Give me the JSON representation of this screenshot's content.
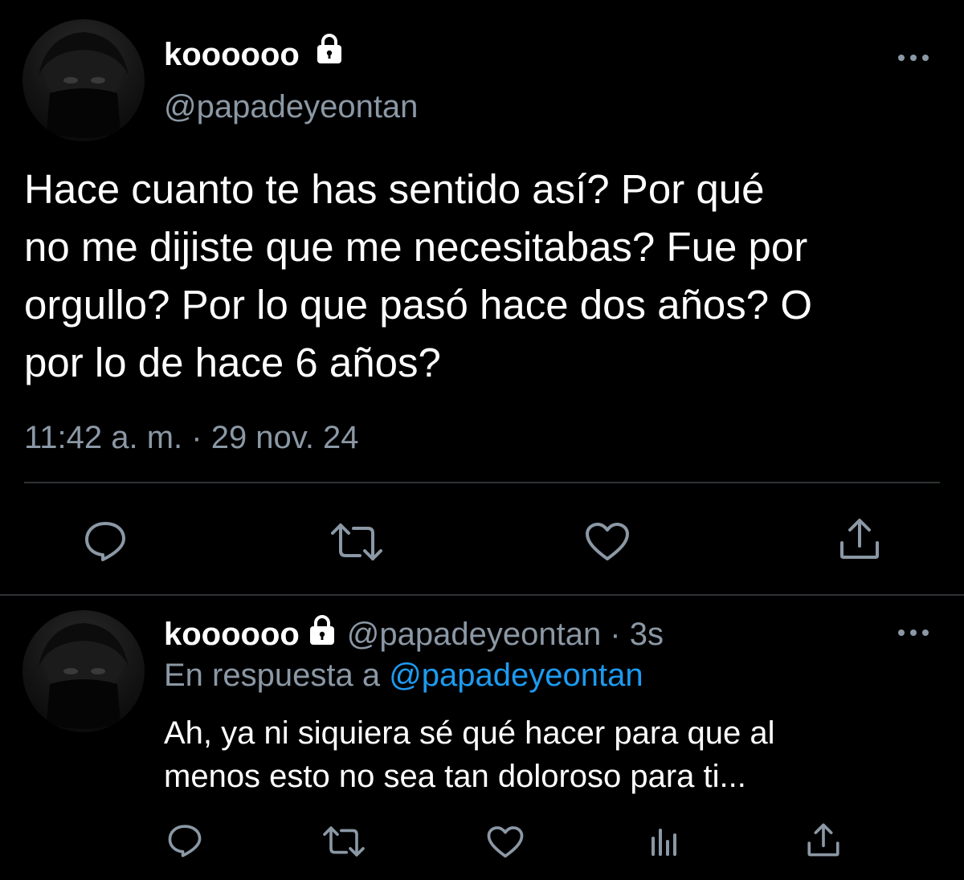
{
  "main_tweet": {
    "display_name": "koooooo",
    "handle": "@papadeyeontan",
    "text_lines": [
      "Hace cuanto te has sentido así? Por qué",
      "no me dijiste que me necesitabas? Fue por",
      "orgullo? Por lo que pasó hace dos años? O",
      "por lo de hace 6 años?"
    ],
    "timestamp": "11:42 a. m. · 29 nov. 24",
    "more_icon": "more-dots-icon",
    "actions": [
      "reply-icon",
      "retweet-icon",
      "like-icon",
      "share-icon"
    ]
  },
  "reply_tweet": {
    "display_name": "koooooo",
    "handle_time": "@papadeyeontan · 3s",
    "replying_prefix": "En respuesta a",
    "replying_to": "@papadeyeontan",
    "text_lines": [
      "Ah, ya ni siquiera sé qué hacer para que al",
      "menos esto no sea tan doloroso para ti..."
    ],
    "more_icon": "more-dots-icon",
    "actions": [
      "reply-icon",
      "retweet-icon",
      "like-icon",
      "analytics-icon",
      "share-icon"
    ]
  },
  "colors": {
    "background": "#000000",
    "text": "#ffffff",
    "muted": "#8b98a5",
    "link": "#1d9bf0",
    "divider": "#2f3336"
  }
}
